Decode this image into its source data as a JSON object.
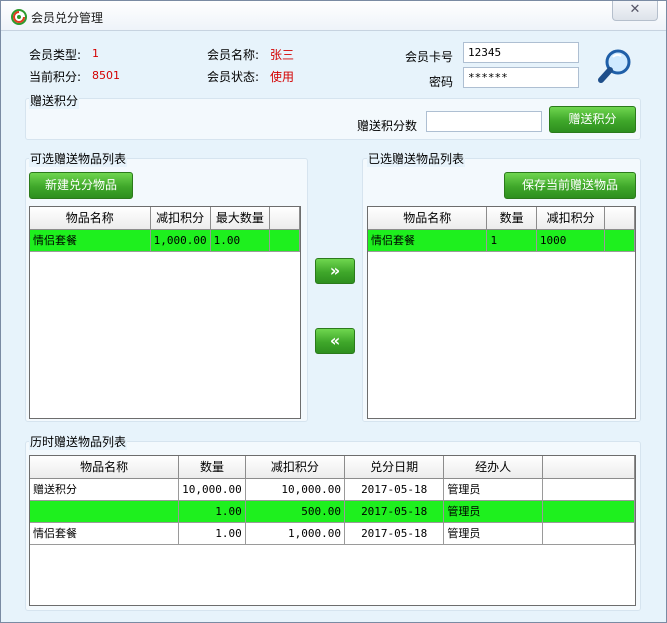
{
  "window": {
    "title": "会员兑分管理",
    "close_symbol": "✕"
  },
  "member": {
    "type_label": "会员类型:",
    "type_value": "1",
    "name_label": "会员名称:",
    "name_value": "张三",
    "points_label": "当前积分:",
    "points_value": "8501",
    "status_label": "会员状态:",
    "status_value": "使用",
    "card_label": "会员卡号",
    "card_value": "12345",
    "password_label": "密码",
    "password_value": "******"
  },
  "gift": {
    "section_title": "赠送积分",
    "points_label": "赠送积分数",
    "points_value": "",
    "button": "赠送积分"
  },
  "available": {
    "section_title": "可选赠送物品列表",
    "new_button": "新建兑分物品",
    "columns": [
      "物品名称",
      "减扣积分",
      "最大数量"
    ],
    "rows": [
      {
        "name": "情侣套餐",
        "points": "1,000.00",
        "max": "1.00"
      }
    ]
  },
  "transfer": {
    "add": "»",
    "remove": "«"
  },
  "selected": {
    "section_title": "已选赠送物品列表",
    "save_button": "保存当前赠送物品",
    "columns": [
      "物品名称",
      "数量",
      "减扣积分"
    ],
    "rows": [
      {
        "name": "情侣套餐",
        "qty": "1",
        "points": "1000"
      }
    ]
  },
  "history": {
    "section_title": "历时赠送物品列表",
    "columns": [
      "物品名称",
      "数量",
      "减扣积分",
      "兑分日期",
      "经办人"
    ],
    "rows": [
      {
        "name": "赠送积分",
        "qty": "10,000.00",
        "points": "10,000.00",
        "date": "2017-05-18",
        "operator": "管理员"
      },
      {
        "name": "",
        "qty": "1.00",
        "points": "500.00",
        "date": "2017-05-18",
        "operator": "管理员"
      },
      {
        "name": "情侣套餐",
        "qty": "1.00",
        "points": "1,000.00",
        "date": "2017-05-18",
        "operator": "管理员"
      }
    ]
  },
  "colors": {
    "window_bg": "#e7f3fb",
    "button_green": "#3fa72a",
    "selected_row": "#1ef01e",
    "value_red": "#d40000"
  }
}
